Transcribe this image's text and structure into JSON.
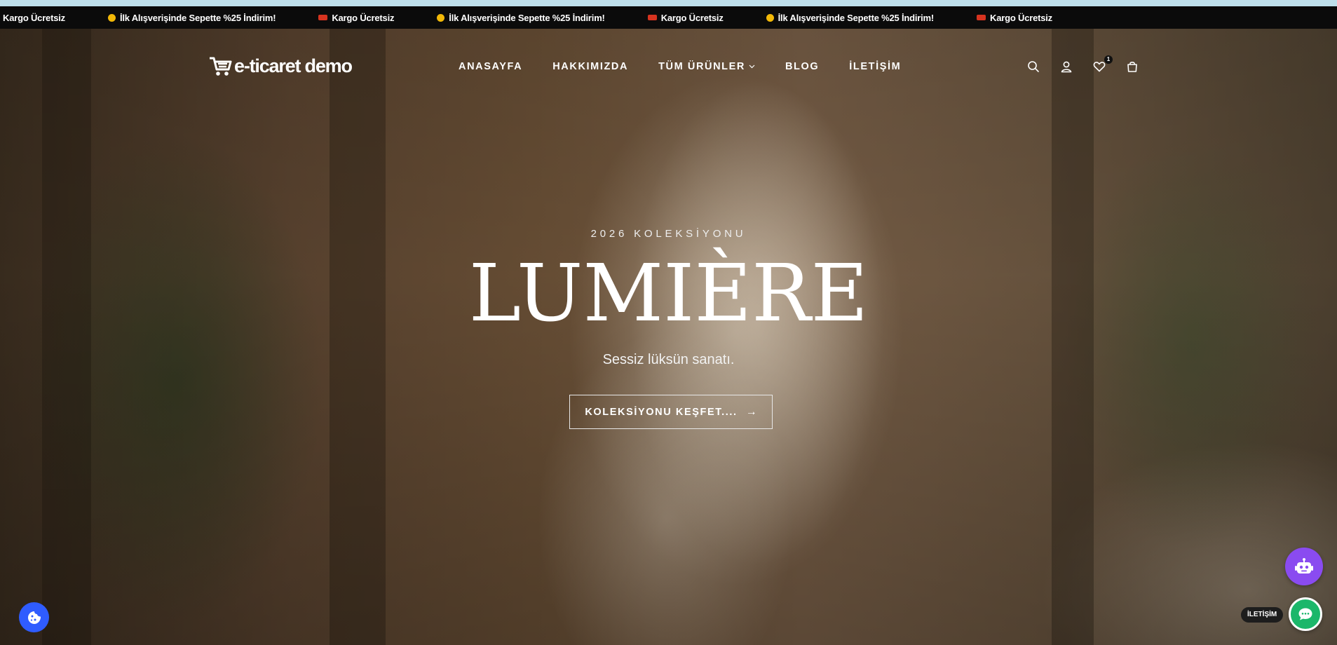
{
  "announcement": {
    "items": [
      {
        "icon": "truck-icon",
        "text": "Kargo Ücretsiz"
      },
      {
        "icon": "smile-icon",
        "text": "İlk Alışverişinde Sepette %25 İndirim!"
      },
      {
        "icon": "truck-icon",
        "text": "Kargo Ücretsiz"
      },
      {
        "icon": "smile-icon",
        "text": "İlk Alışverişinde Sepette %25 İndirim!"
      },
      {
        "icon": "truck-icon",
        "text": "Kargo Ücretsiz"
      },
      {
        "icon": "smile-icon",
        "text": "İlk Alışverişinde Sepette %25 İndirim!"
      },
      {
        "icon": "truck-icon",
        "text": "Kargo Ücretsiz"
      }
    ]
  },
  "header": {
    "logo_text": "e-ticaret demo",
    "nav": [
      {
        "label": "ANASAYFA"
      },
      {
        "label": "HAKKIMIZDA"
      },
      {
        "label": "TÜM ÜRÜNLER"
      },
      {
        "label": "BLOG"
      },
      {
        "label": "İLETİŞİM"
      }
    ],
    "wishlist_count": "1"
  },
  "hero": {
    "subtitle": "2026 KOLEKSİYONU",
    "title": "LUMIÈRE",
    "tagline": "Sessiz lüksün sanatı.",
    "cta_label": "KOLEKSİYONU KEŞFET....",
    "cta_arrow": "→"
  },
  "widgets": {
    "contact_label": "İLETİŞİM"
  },
  "colors": {
    "announcement_bg": "#0b0b0b",
    "cookie_button": "#2f5cff",
    "bot_button": "#8a4bf0",
    "chat_button": "#1bb76a"
  }
}
